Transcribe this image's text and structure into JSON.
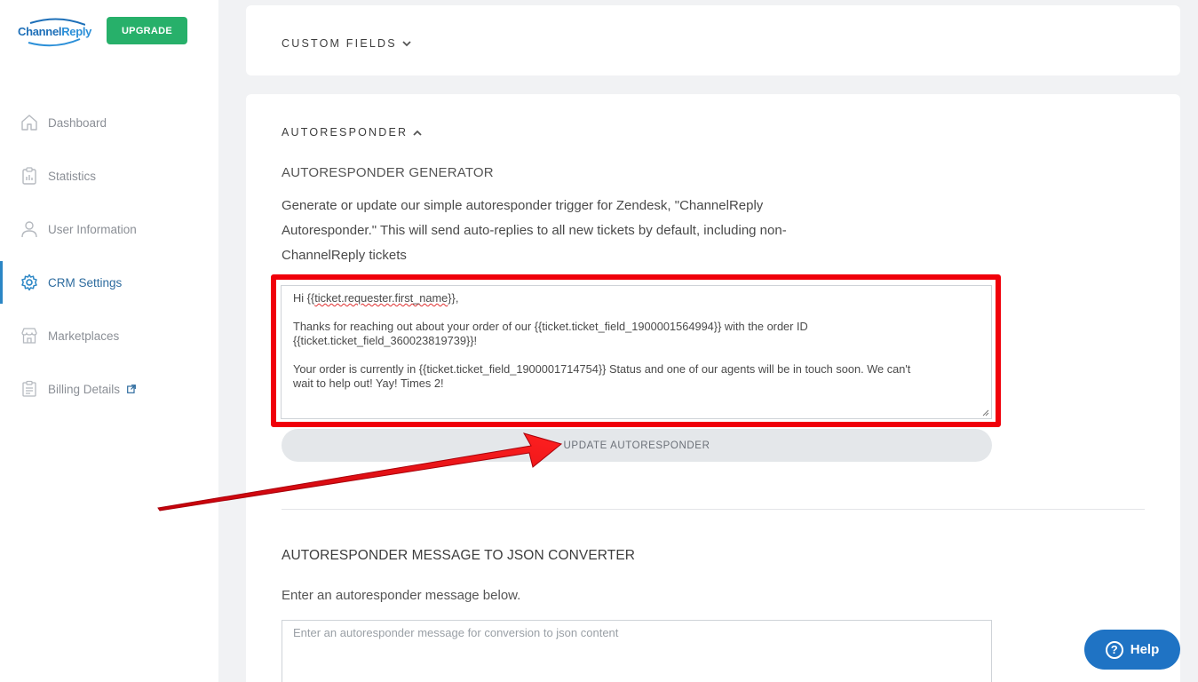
{
  "brand": {
    "logo_channel": "Channel",
    "logo_reply": "Reply",
    "upgrade_label": "UPGRADE",
    "accent": "#27b06a",
    "primary": "#1f73c4"
  },
  "sidebar": {
    "items": [
      {
        "label": "Dashboard",
        "icon": "home-icon",
        "active": false
      },
      {
        "label": "Statistics",
        "icon": "clipboard-chart-icon",
        "active": false
      },
      {
        "label": "User Information",
        "icon": "user-icon",
        "active": false
      },
      {
        "label": "CRM Settings",
        "icon": "gear-icon",
        "active": true
      },
      {
        "label": "Marketplaces",
        "icon": "store-icon",
        "active": false
      },
      {
        "label": "Billing Details",
        "icon": "receipt-icon",
        "active": false,
        "external": true
      }
    ]
  },
  "custom_fields": {
    "title": "CUSTOM FIELDS"
  },
  "autoresponder": {
    "title": "AUTORESPONDER",
    "generator_title": "AUTORESPONDER GENERATOR",
    "description_line1": "Generate or update our simple autoresponder trigger for Zendesk, \"ChannelReply",
    "description_line2": "Autoresponder.\" This will send auto-replies to all new tickets by default, including non-",
    "description_line3": "ChannelReply tickets",
    "message": {
      "greeting_prefix": "Hi {{",
      "greeting_var": "ticket.requester.first_name",
      "greeting_suffix": "}},",
      "line2": "Thanks for reaching out about your order of our {{ticket.ticket_field_1900001564994}} with the order ID",
      "line3": "{{ticket.ticket_field_360023819739}}!",
      "line4": "Your order is currently in {{ticket.ticket_field_1900001714754}} Status and one of our agents will be in touch soon. We can't",
      "line5": "wait to help out! Yay! Times 2!"
    },
    "update_button": "UPDATE AUTORESPONDER",
    "highlight_color": "#f0000a"
  },
  "converter": {
    "title": "AUTORESPONDER MESSAGE TO JSON CONVERTER",
    "label": "Enter an autoresponder message below.",
    "placeholder": "Enter an autoresponder message for conversion to json content"
  },
  "help": {
    "label": "Help"
  }
}
